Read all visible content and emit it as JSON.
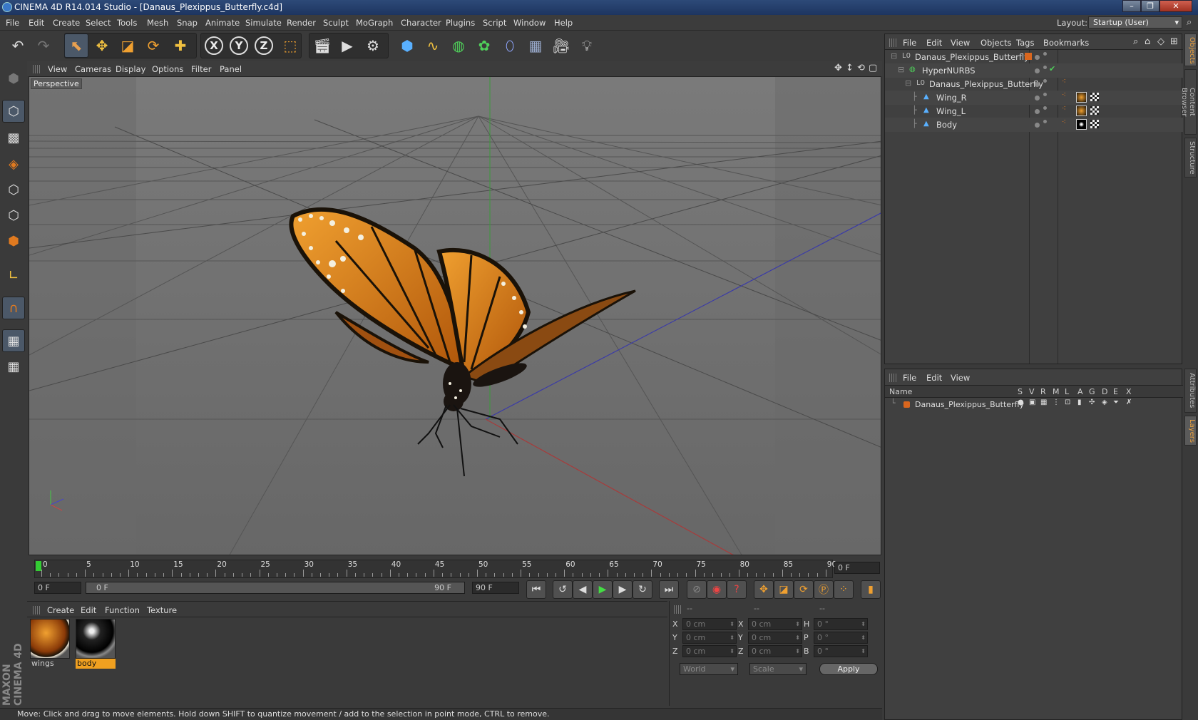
{
  "title": "CINEMA 4D R14.014 Studio - [Danaus_Plexippus_Butterfly.c4d]",
  "window_buttons": [
    "–",
    "❐",
    "✕"
  ],
  "menu": [
    "File",
    "Edit",
    "Create",
    "Select",
    "Tools",
    "Mesh",
    "Snap",
    "Animate",
    "Simulate",
    "Render",
    "Sculpt",
    "MoGraph",
    "Character",
    "Plugins",
    "Script",
    "Window",
    "Help"
  ],
  "layout": {
    "label": "Layout:",
    "value": "Startup (User)"
  },
  "viewport": {
    "menu": [
      "View",
      "Cameras",
      "Display",
      "Options",
      "Filter",
      "Panel"
    ],
    "label": "Perspective"
  },
  "timeline": {
    "ticks": [
      "0",
      "5",
      "10",
      "15",
      "20",
      "25",
      "30",
      "35",
      "40",
      "45",
      "50",
      "55",
      "60",
      "65",
      "70",
      "75",
      "80",
      "85",
      "90"
    ],
    "current_frame": "0 F"
  },
  "controls": {
    "start_field": "0 F",
    "range_start": "0 F",
    "range_end": "90 F",
    "end_field": "90 F"
  },
  "material_panel": {
    "menu": [
      "Create",
      "Edit",
      "Function",
      "Texture"
    ],
    "materials": [
      {
        "name": "wings",
        "selected": false
      },
      {
        "name": "body",
        "selected": true
      }
    ]
  },
  "coord_panel": {
    "headers": [
      "--",
      "--",
      "--"
    ],
    "rows": [
      {
        "a": "X",
        "av": "0 cm",
        "b": "X",
        "bv": "0 cm",
        "c": "H",
        "cv": "0 °"
      },
      {
        "a": "Y",
        "av": "0 cm",
        "b": "Y",
        "bv": "0 cm",
        "c": "P",
        "cv": "0 °"
      },
      {
        "a": "Z",
        "av": "0 cm",
        "b": "Z",
        "bv": "0 cm",
        "c": "B",
        "cv": "0 °"
      }
    ],
    "world": "World",
    "scale": "Scale",
    "apply": "Apply"
  },
  "status": "Move: Click and drag to move elements. Hold down SHIFT to quantize movement / add to the selection in point mode, CTRL to remove.",
  "objects_panel": {
    "menu": [
      "File",
      "Edit",
      "View",
      "Objects",
      "Tags",
      "Bookmarks"
    ],
    "items": [
      {
        "name": "Danaus_Plexippus_Butterfly",
        "indent": 0,
        "type": "null"
      },
      {
        "name": "HyperNURBS",
        "indent": 1,
        "type": "hypernurbs"
      },
      {
        "name": "Danaus_Plexippus_Butterfly",
        "indent": 2,
        "type": "null"
      },
      {
        "name": "Wing_R",
        "indent": 3,
        "type": "poly"
      },
      {
        "name": "Wing_L",
        "indent": 3,
        "type": "poly"
      },
      {
        "name": "Body",
        "indent": 3,
        "type": "poly"
      }
    ]
  },
  "layers_panel": {
    "menu": [
      "File",
      "Edit",
      "View"
    ],
    "columns": [
      "Name",
      "S",
      "V",
      "R",
      "M",
      "L",
      "A",
      "G",
      "D",
      "E",
      "X"
    ],
    "layer": "Danaus_Plexippus_Butterfly"
  },
  "side_tabs": [
    "Objects",
    "Content Browser",
    "Structure",
    "Attributes",
    "Layers"
  ],
  "branding": "MAXON CINEMA 4D",
  "colors": {
    "accent": "#e07a20",
    "selected_bg": "#4b5868",
    "layer_orange": "#d9661e"
  }
}
